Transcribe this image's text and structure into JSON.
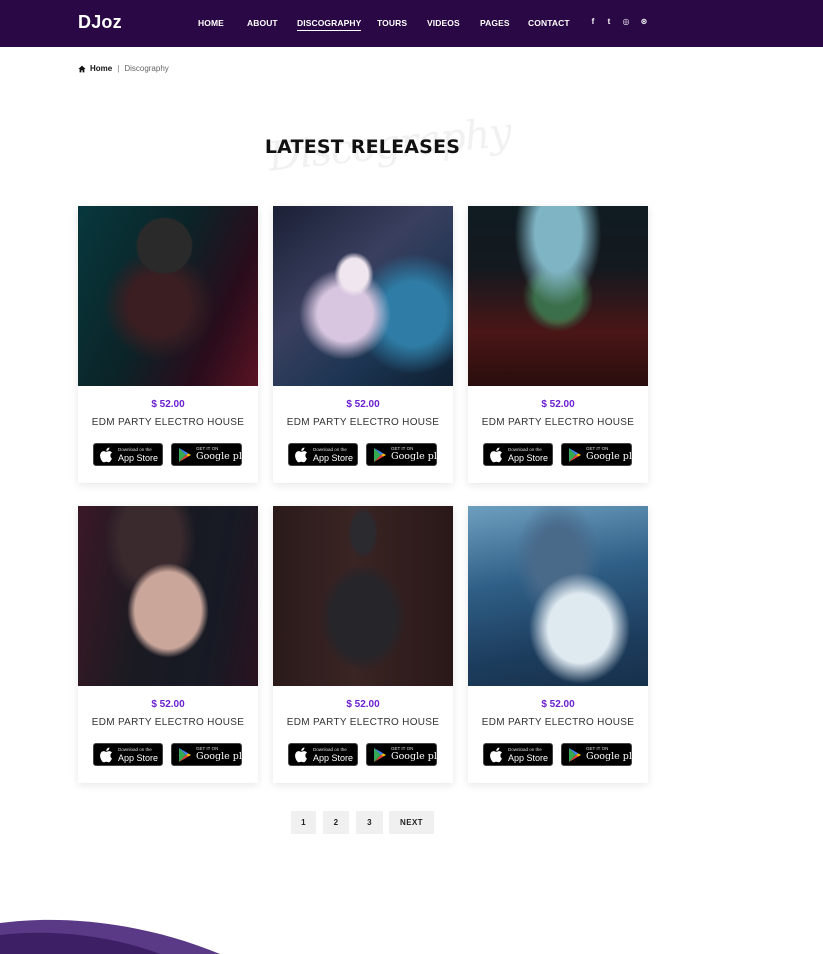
{
  "header": {
    "logo": "DJoz",
    "nav": [
      {
        "label": "HOME",
        "active": false
      },
      {
        "label": "ABOUT",
        "active": false
      },
      {
        "label": "DISCOGRAPHY",
        "active": true
      },
      {
        "label": "TOURS",
        "active": false
      },
      {
        "label": "VIDEOS",
        "active": false
      },
      {
        "label": "PAGES",
        "active": false
      },
      {
        "label": "CONTACT",
        "active": false
      }
    ],
    "social": [
      {
        "icon": "facebook-icon",
        "glyph": "f"
      },
      {
        "icon": "twitter-icon",
        "glyph": "t"
      },
      {
        "icon": "instagram-icon",
        "glyph": "◎"
      },
      {
        "icon": "dribbble-icon",
        "glyph": "⊛"
      }
    ]
  },
  "breadcrumb": {
    "home": "Home",
    "separator": "|",
    "current": "Discography"
  },
  "section": {
    "script_text": "Discography",
    "title": "LATEST RELEASES"
  },
  "store_badges": {
    "apple_small": "Download on the",
    "apple_big": "App Store",
    "google_small": "GET IT ON",
    "google_big": "Google play"
  },
  "releases": [
    {
      "price": "$ 52.00",
      "name": "EDM PARTY ELECTRO HOUSE",
      "art": "dj-woman-neon"
    },
    {
      "price": "$ 52.00",
      "name": "EDM PARTY ELECTRO HOUSE",
      "art": "white-hair-fantasy"
    },
    {
      "price": "$ 52.00",
      "name": "EDM PARTY ELECTRO HOUSE",
      "art": "painted-face-smoke"
    },
    {
      "price": "$ 52.00",
      "name": "EDM PARTY ELECTRO HOUSE",
      "art": "tattooed-arms"
    },
    {
      "price": "$ 52.00",
      "name": "EDM PARTY ELECTRO HOUSE",
      "art": "mannequin"
    },
    {
      "price": "$ 52.00",
      "name": "EDM PARTY ELECTRO HOUSE",
      "art": "underwater-dress"
    }
  ],
  "pagination": [
    "1",
    "2",
    "3",
    "NEXT"
  ],
  "colors": {
    "header_bg": "#2a0845",
    "price": "#6b1fd1",
    "wave": "#5a3a86"
  }
}
